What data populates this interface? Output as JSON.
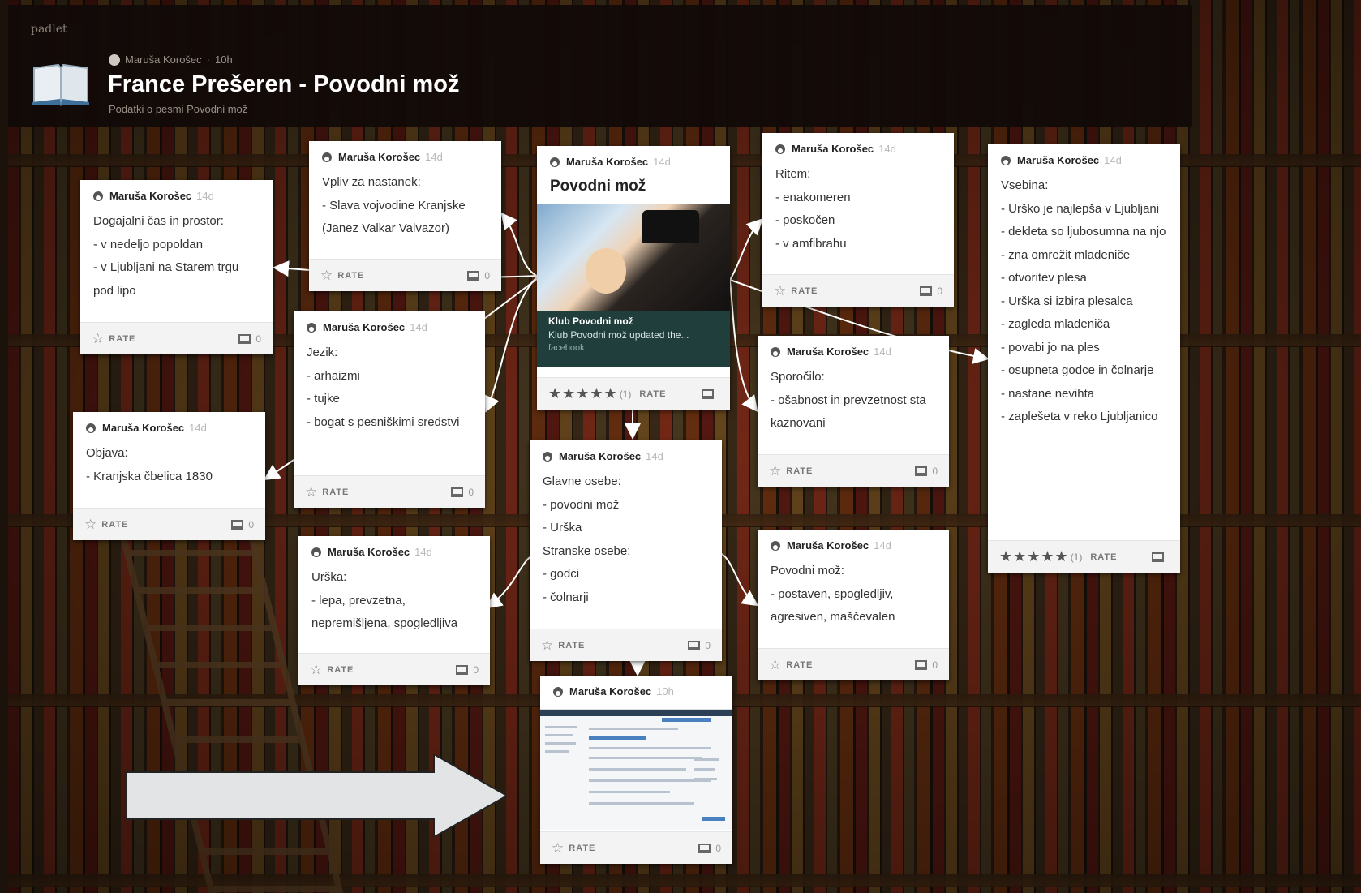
{
  "brand": "padlet",
  "header": {
    "author": "Maruša Korošec",
    "time": "10h",
    "title": "France Prešeren - Povodni mož",
    "subtitle": "Podatki o pesmi Povodni mož"
  },
  "common": {
    "rate_label": "RATE"
  },
  "posts": [
    {
      "author": "Maruša Korošec",
      "time": "14d",
      "body": "Dogajalni čas in prostor:\n- v nedeljo popoldan\n- v Ljubljani na Starem trgu pod lipo",
      "comments": "0"
    },
    {
      "author": "Maruša Korošec",
      "time": "14d",
      "body": "Vpliv za nastanek:\n- Slava vojvodine Kranjske (Janez Valkar Valvazor)",
      "comments": "0"
    },
    {
      "author": "Maruša Korošec",
      "time": "14d",
      "title": "Povodni mož",
      "link_title": "Klub Povodni mož",
      "link_desc": "Klub Povodni mož updated the...",
      "link_source": "facebook",
      "stars": "★★★★★",
      "star_count": "(1)"
    },
    {
      "author": "Maruša Korošec",
      "time": "14d",
      "body": "Ritem:\n- enakomeren\n- poskočen\n- v amfibrahu",
      "comments": "0"
    },
    {
      "author": "Maruša Korošec",
      "time": "14d",
      "body": "Vsebina:\n- Urško je najlepša v Ljubljani\n- dekleta so ljubosumna na njo\n- zna omrežit mladeniče\n- otvoritev plesa\n- Urška si izbira plesalca\n- zagleda mladeniča\n- povabi jo na ples\n- osupneta godce in čolnarje\n- nastane nevihta\n- zaplešeta v reko Ljubljanico",
      "stars": "★★★★★",
      "star_count": "(1)"
    },
    {
      "author": "Maruša Korošec",
      "time": "14d",
      "body": "Jezik:\n- arhaizmi\n- tujke\n- bogat s pesniškimi sredstvi",
      "comments": "0"
    },
    {
      "author": "Maruša Korošec",
      "time": "14d",
      "body": "Sporočilo:\n- ošabnost in prevzetnost sta kaznovani",
      "comments": "0"
    },
    {
      "author": "Maruša Korošec",
      "time": "14d",
      "body": "Objava:\n- Kranjska čbelica 1830",
      "comments": "0"
    },
    {
      "author": "Maruša Korošec",
      "time": "14d",
      "body": "Glavne osebe:\n- povodni mož\n- Urška\nStranske osebe:\n- godci\n- čolnarji",
      "comments": "0"
    },
    {
      "author": "Maruša Korošec",
      "time": "14d",
      "body": "Urška:\n- lepa, prevzetna, nepremišljena, spogledljiva",
      "comments": "0"
    },
    {
      "author": "Maruša Korošec",
      "time": "14d",
      "body": "Povodni mož:\n- postaven, spogledljiv, agresiven, maščevalen",
      "comments": "0"
    },
    {
      "author": "Maruša Korošec",
      "time": "10h",
      "comments": "0"
    }
  ]
}
